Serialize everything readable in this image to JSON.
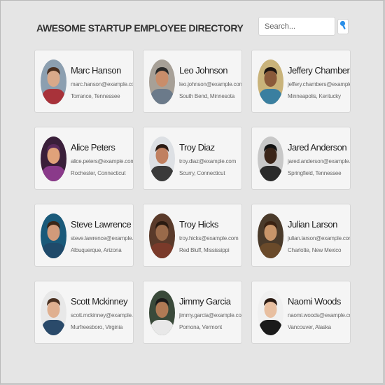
{
  "header": {
    "title": "AWESOME STARTUP EMPLOYEE DIRECTORY"
  },
  "search": {
    "placeholder": "Search...",
    "button_icon": "search-icon",
    "accent_color": "#2b8fe8"
  },
  "employees": [
    {
      "name": "Marc Hanson",
      "email": "marc.hanson@example.com",
      "location": "Torrance, Tennessee",
      "photo": {
        "skin": "#d9a98a",
        "hair": "#4a2e1e",
        "shirt": "#a8323a",
        "bg": "#8c9fb0"
      }
    },
    {
      "name": "Leo Johnson",
      "email": "leo.johnson@example.com",
      "location": "South Bend, Minnesota",
      "photo": {
        "skin": "#c98d6a",
        "hair": "#2a2a2a",
        "shirt": "#6b7a8a",
        "bg": "#a7a097"
      }
    },
    {
      "name": "Jeffery Chambers",
      "email": "jeffery.chambers@example.com",
      "location": "Minneapolis, Kentucky",
      "photo": {
        "skin": "#8a5a3a",
        "hair": "#1b1410",
        "shirt": "#3a7fa0",
        "bg": "#c9b37a"
      }
    },
    {
      "name": "Alice Peters",
      "email": "alice.peters@example.com",
      "location": "Rochester, Connecticut",
      "photo": {
        "skin": "#e0a27a",
        "hair": "#5a2a5a",
        "shirt": "#8a3a8a",
        "bg": "#3a1f3a"
      }
    },
    {
      "name": "Troy Diaz",
      "email": "troy.diaz@example.com",
      "location": "Scurry, Connecticut",
      "photo": {
        "skin": "#c08060",
        "hair": "#2a1a12",
        "shirt": "#3a3a3a",
        "bg": "#dde0e4"
      }
    },
    {
      "name": "Jared Anderson",
      "email": "jared.anderson@example.com",
      "location": "Springfield, Tennessee",
      "photo": {
        "skin": "#3a2418",
        "hair": "#111111",
        "shirt": "#2a2a2a",
        "bg": "#c8c8c8"
      }
    },
    {
      "name": "Steve Lawrence",
      "email": "steve.lawrence@example.com",
      "location": "Albuquerque, Arizona",
      "photo": {
        "skin": "#d29a7a",
        "hair": "#3a2618",
        "shirt": "#1f4a6a",
        "bg": "#1a5a7a"
      }
    },
    {
      "name": "Troy Hicks",
      "email": "troy.hicks@example.com",
      "location": "Red Bluff, Mississippi",
      "photo": {
        "skin": "#9a6a4a",
        "hair": "#2a1a10",
        "shirt": "#7a3a2a",
        "bg": "#5a3a2a"
      }
    },
    {
      "name": "Julian Larson",
      "email": "julian.larson@example.com",
      "location": "Charlotte, New Mexico",
      "photo": {
        "skin": "#c8956a",
        "hair": "#3a2212",
        "shirt": "#6a4a2a",
        "bg": "#4a3a2a"
      }
    },
    {
      "name": "Scott Mckinney",
      "email": "scott.mckinney@example.com",
      "location": "Murfreesboro, Virginia",
      "photo": {
        "skin": "#e0b090",
        "hair": "#4a3020",
        "shirt": "#2a4a6a",
        "bg": "#e8e8e8"
      }
    },
    {
      "name": "Jimmy Garcia",
      "email": "jimmy.garcia@example.com",
      "location": "Pomona, Vermont",
      "photo": {
        "skin": "#b07a55",
        "hair": "#1a1a1a",
        "shirt": "#e8e8e8",
        "bg": "#3a4a3a"
      }
    },
    {
      "name": "Naomi Woods",
      "email": "naomi.woods@example.com",
      "location": "Vancouver, Alaska",
      "photo": {
        "skin": "#e8bfa0",
        "hair": "#2a1a12",
        "shirt": "#1a1a1a",
        "bg": "#f0f0f0"
      }
    }
  ]
}
